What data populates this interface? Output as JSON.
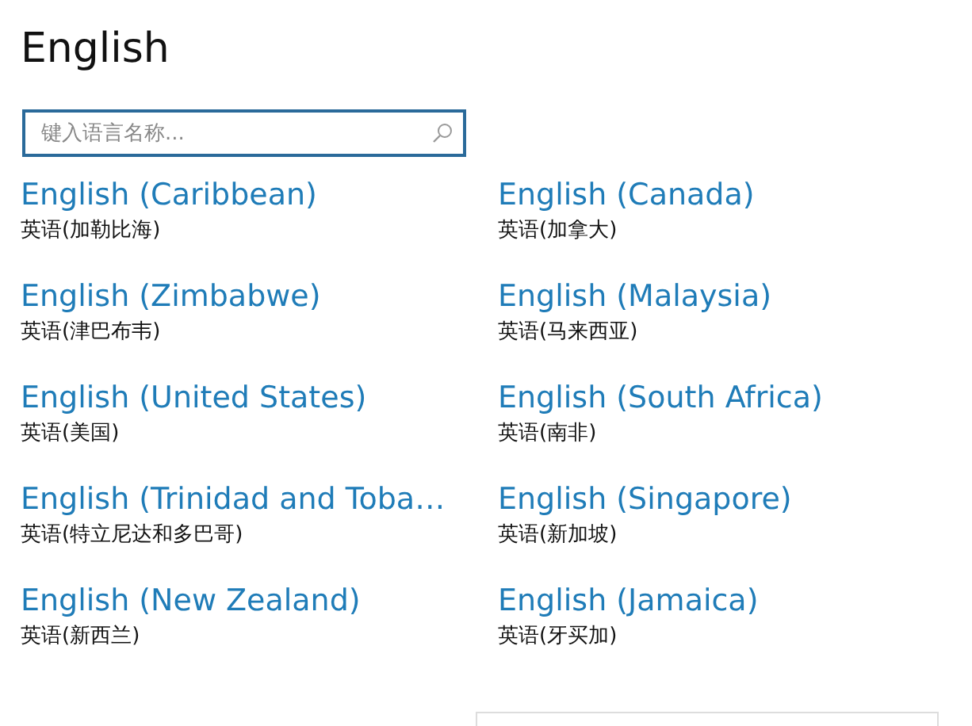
{
  "title": "English",
  "search": {
    "placeholder": "键入语言名称..."
  },
  "languages": [
    {
      "name": "English (Caribbean)",
      "native": "英语(加勒比海)"
    },
    {
      "name": "English (Canada)",
      "native": "英语(加拿大)"
    },
    {
      "name": "English (Zimbabwe)",
      "native": "英语(津巴布韦)"
    },
    {
      "name": "English (Malaysia)",
      "native": "英语(马来西亚)"
    },
    {
      "name": "English (United States)",
      "native": "英语(美国)"
    },
    {
      "name": "English (South Africa)",
      "native": "英语(南非)"
    },
    {
      "name": "English (Trinidad and Toba…",
      "native": "英语(特立尼达和多巴哥)"
    },
    {
      "name": "English (Singapore)",
      "native": "英语(新加坡)"
    },
    {
      "name": "English (New Zealand)",
      "native": "英语(新西兰)"
    },
    {
      "name": "English (Jamaica)",
      "native": "英语(牙买加)"
    }
  ]
}
